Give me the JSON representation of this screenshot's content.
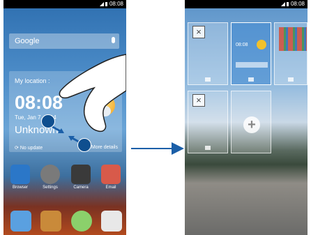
{
  "left_screen": {
    "status": {
      "time": "08:08"
    },
    "search": {
      "label": "Google"
    },
    "weather": {
      "location_label": "My location :",
      "time": "08:08",
      "date": "Tue, Jan 7, 2014",
      "city": "Unknown",
      "update_label": "No update",
      "details_label": "More details"
    },
    "apps": [
      {
        "label": "Browser",
        "icon": "browser-icon",
        "color": "#2b77c8"
      },
      {
        "label": "Settings",
        "icon": "gear-icon",
        "color": "#7a7a7a"
      },
      {
        "label": "Camera",
        "icon": "camera-icon",
        "color": "#3a3a3a"
      },
      {
        "label": "Email",
        "icon": "email-icon",
        "color": "#d85a4a"
      }
    ],
    "dock": [
      {
        "icon": "phone-icon",
        "color": "#5aa0e0"
      },
      {
        "icon": "contacts-icon",
        "color": "#c98a3a"
      },
      {
        "icon": "messages-icon",
        "color": "#8bd06b"
      },
      {
        "icon": "play-store-icon",
        "color": "#e8e8e8"
      }
    ]
  },
  "right_screen": {
    "status": {
      "time": "08:08"
    },
    "thumbnail": {
      "time": "08:08"
    },
    "close_symbol": "×",
    "add_symbol": "+"
  },
  "colors": {
    "arrow": "#1b5fa8",
    "finger_marker": "#0f4f8f"
  }
}
